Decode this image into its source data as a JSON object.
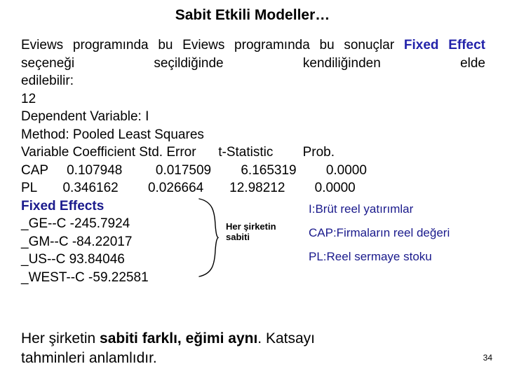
{
  "slide": {
    "title": "Sabit Etkili Modeller…",
    "page_number": "34",
    "paragraph": {
      "line1": "Eviews  programında  bu  Eviews  programında  bu  sonuçlar",
      "line2_pre": "",
      "line2_highlight": "Fixed   Effect",
      "line2_post": "  seçeneği  seçildiğinde  kendiliğinden  elde",
      "line3": "edilebilir:"
    },
    "output": {
      "line_12": "12",
      "dependent": "Dependent Variable: I",
      "method": "Method: Pooled Least Squares",
      "header": "Variable Coefficient Std. Error      t-Statistic        Prob.",
      "rows": [
        "CAP     0.107948         0.017509        6.165319        0.0000",
        "PL       0.346162        0.026664       12.98212        0.0000"
      ]
    },
    "fixed_effects": {
      "heading": "Fixed Effects",
      "rows": [
        "_GE--C -245.7924",
        "_GM--C -84.22017",
        "_US--C 93.84046",
        "_WEST--C -59.22581"
      ],
      "side_note_line1": "Her şirketin",
      "side_note_line2": "sabiti"
    },
    "legend": [
      "I:Brüt reel yatırımlar",
      "CAP:Firmaların reel değeri",
      "PL:Reel sermaye stoku"
    ],
    "footer": {
      "pre": "Her şirketin ",
      "bold": "sabiti farklı, eğimi aynı",
      "post": ". Katsayı",
      "line2": "tahminleri anlamlıdır."
    },
    "colors": {
      "accent_blue": "#2222aa",
      "navy": "#1a1a8c",
      "text": "#000000",
      "background": "#ffffff"
    }
  }
}
